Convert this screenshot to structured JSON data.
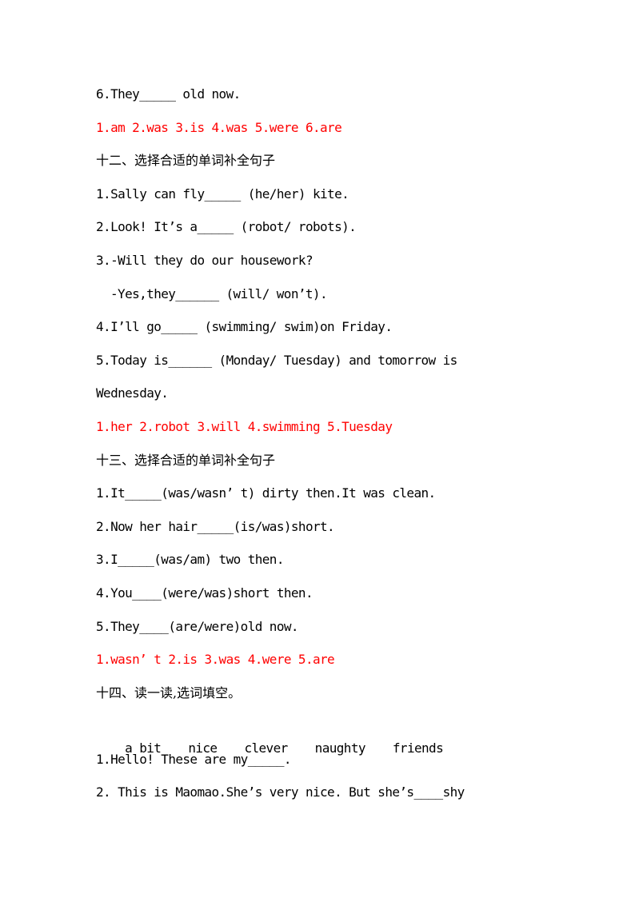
{
  "document": {
    "block_11_tail": {
      "questions": [
        "6.They_____ old now."
      ],
      "answer": "1.am 2.was 3.is 4.was 5.were 6.are"
    },
    "section_12": {
      "heading": "十二、选择合适的单词补全句子",
      "questions": [
        "1.Sally can fly_____ (he/her) kite.",
        "2.Look! It’s a_____ (robot/ robots).",
        "3.-Will they do our housework?",
        "-Yes,they______ (will/ won’t).",
        "4.I’ll go_____ (swimming/ swim)on Friday.",
        "5.Today is______ (Monday/ Tuesday) and tomorrow is",
        "Wednesday."
      ],
      "answer": "1.her 2.robot 3.will 4.swimming 5.Tuesday"
    },
    "section_13": {
      "heading": "十三、选择合适的单词补全句子",
      "questions": [
        "1.It_____(was/wasn’ t) dirty then.It was clean.",
        "2.Now her hair_____(is/was)short.",
        "3.I_____(was/am) two then.",
        "4.You____(were/was)short then.",
        "5.They____(are/were)old now."
      ],
      "answer": "1.wasn’ t 2.is 3.was 4.were 5.are"
    },
    "section_14": {
      "heading": "十四、读一读,选词填空。",
      "word_bank": [
        "a bit",
        "nice",
        "clever",
        "naughty",
        "friends"
      ],
      "questions": [
        "1.Hello! These are my_____.",
        "2. This is Maomao.She’s very nice. But she’s____shy"
      ]
    },
    "colors": {
      "text": "#000000",
      "answer": "#ff0000"
    }
  }
}
